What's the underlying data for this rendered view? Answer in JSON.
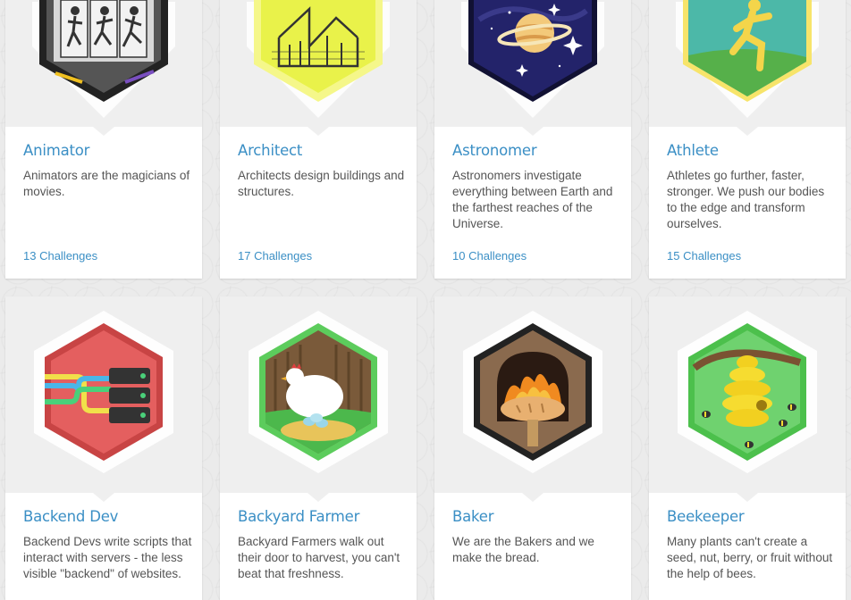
{
  "cards": [
    {
      "title": "Animator",
      "description": "Animators are the magicians of movies.",
      "challenges": "13 Challenges",
      "icon": "animator-badge-icon"
    },
    {
      "title": "Architect",
      "description": "Architects design buildings and structures.",
      "challenges": "17 Challenges",
      "icon": "architect-badge-icon"
    },
    {
      "title": "Astronomer",
      "description": "Astronomers investigate everything between Earth and the farthest reaches of the Universe.",
      "challenges": "10 Challenges",
      "icon": "astronomer-badge-icon"
    },
    {
      "title": "Athlete",
      "description": "Athletes go further, faster, stronger. We push our bodies to the edge and transform ourselves.",
      "challenges": "15 Challenges",
      "icon": "athlete-badge-icon"
    },
    {
      "title": "Backend Dev",
      "description": "Backend Devs write scripts that interact with servers - the less visible \"backend\" of websites.",
      "icon": "backend-dev-badge-icon"
    },
    {
      "title": "Backyard Farmer",
      "description": "Backyard Farmers walk out their door to harvest, you can't beat that freshness.",
      "icon": "backyard-farmer-badge-icon"
    },
    {
      "title": "Baker",
      "description": "We are the Bakers and we make the bread.",
      "icon": "baker-badge-icon"
    },
    {
      "title": "Beekeeper",
      "description": "Many plants can't create a seed, nut, berry, or fruit without the help of bees.",
      "icon": "beekeeper-badge-icon"
    }
  ],
  "colors": {
    "link": "#3b8fc5",
    "text": "#555555",
    "page_background": "#ebebeb"
  }
}
